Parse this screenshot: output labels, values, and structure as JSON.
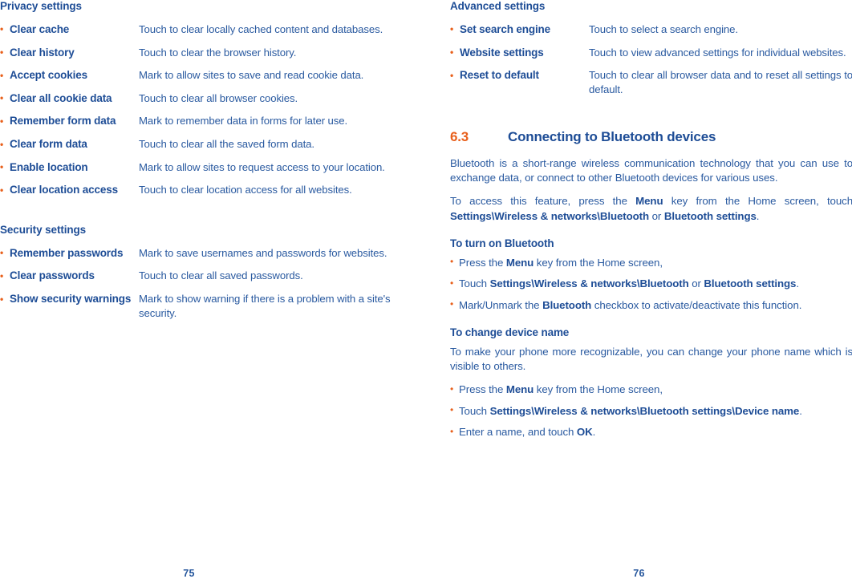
{
  "colors": {
    "text_blue": "#2a5aa0",
    "heading_blue": "#1e4d96",
    "bullet_orange": "#e8601c"
  },
  "left_page": {
    "page_number": "75",
    "sections": [
      {
        "heading": "Privacy settings",
        "rows": [
          {
            "term": "Clear cache",
            "desc": "Touch to clear locally cached content and databases."
          },
          {
            "term": "Clear history",
            "desc": "Touch to clear the browser history."
          },
          {
            "term": "Accept cookies",
            "desc": "Mark to allow sites to save and read cookie data."
          },
          {
            "term": "Clear all cookie data",
            "desc": "Touch to clear all browser cookies."
          },
          {
            "term": "Remember form data",
            "desc": "Mark to remember data in forms for later use."
          },
          {
            "term": "Clear form data",
            "desc": "Touch to clear all the saved form data."
          },
          {
            "term": "Enable location",
            "desc": "Mark to allow sites to request access to your location."
          },
          {
            "term": "Clear location access",
            "desc": "Touch to clear location access for all websites."
          }
        ]
      },
      {
        "heading": "Security settings",
        "rows": [
          {
            "term": "Remember passwords",
            "desc": "Mark to save usernames and passwords for websites."
          },
          {
            "term": "Clear passwords",
            "desc": "Touch to clear all saved passwords."
          },
          {
            "term": "Show security warnings",
            "desc": "Mark to show warning if there is a problem with a site's security."
          }
        ]
      }
    ]
  },
  "right_page": {
    "page_number": "76",
    "advanced": {
      "heading": "Advanced settings",
      "rows": [
        {
          "term": "Set search engine",
          "desc": "Touch to select a search engine."
        },
        {
          "term": "Website settings",
          "desc": "Touch to view advanced settings for individual websites."
        },
        {
          "term": "Reset to default",
          "desc": "Touch to clear all browser data and to reset all settings to default."
        }
      ]
    },
    "chapter": {
      "number": "6.3",
      "title": "Connecting to Bluetooth devices",
      "intro": "Bluetooth is a short-range wireless communication technology that you can use to exchange data, or connect to other Bluetooth devices for various uses.",
      "access_paragraph_html": "To access this feature, press the <b>Menu</b> key from the Home screen, touch <b>Settings\\Wireless &amp; networks\\Bluetooth</b> or <b>Bluetooth settings</b>."
    },
    "turn_on": {
      "heading": "To turn on Bluetooth",
      "items_html": [
        "Press the <b>Menu</b> key from the Home screen,",
        "Touch <b>Settings\\Wireless &amp; networks\\Bluetooth</b> or <b>Bluetooth settings</b>.",
        "Mark/Unmark the <b>Bluetooth</b> checkbox to activate/deactivate this function."
      ]
    },
    "change_name": {
      "heading": "To change device name",
      "paragraph": "To make your phone more recognizable, you can change your phone name which is visible to others.",
      "items_html": [
        "Press the <b>Menu</b> key from the Home screen,",
        "Touch <b>Settings\\Wireless &amp; networks\\Bluetooth settings\\Device name</b>.",
        "Enter a name, and touch <b>OK</b>."
      ]
    }
  }
}
